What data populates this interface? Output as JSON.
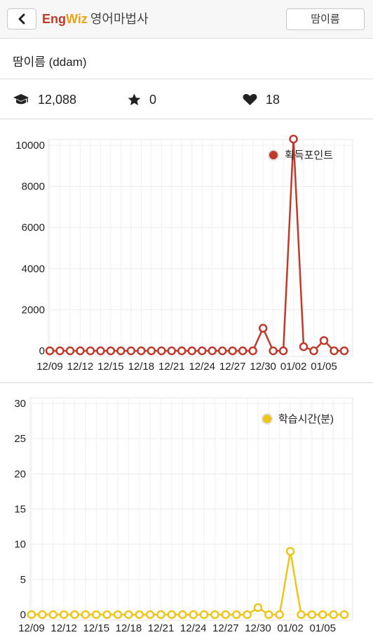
{
  "header": {
    "back_icon": "chevron-left-icon",
    "brand_eng": "Eng",
    "brand_wiz": "Wiz",
    "brand_rest": "영어마법사",
    "user_button": "땀이름"
  },
  "profile": {
    "name": "땀이름 (ddam)"
  },
  "stats": [
    {
      "icon": "graduation-cap-icon",
      "value": "12,088"
    },
    {
      "icon": "star-icon",
      "value": "0"
    },
    {
      "icon": "heart-icon",
      "value": "18"
    }
  ],
  "chart_data": [
    {
      "type": "line",
      "legend": "획득포인트",
      "legend_position": "top-right",
      "color": "#c0392b",
      "grid": true,
      "ylim": [
        0,
        10000
      ],
      "yticks": [
        0,
        2000,
        4000,
        6000,
        8000,
        10000
      ],
      "x": [
        "12/09",
        "12/10",
        "12/11",
        "12/12",
        "12/13",
        "12/14",
        "12/15",
        "12/16",
        "12/17",
        "12/18",
        "12/19",
        "12/20",
        "12/21",
        "12/22",
        "12/23",
        "12/24",
        "12/25",
        "12/26",
        "12/27",
        "12/28",
        "12/29",
        "12/30",
        "12/31",
        "01/01",
        "01/02",
        "01/03",
        "01/04",
        "01/05",
        "01/06",
        "01/07"
      ],
      "xtick_labels": [
        "12/09",
        "12/12",
        "12/15",
        "12/18",
        "12/21",
        "12/24",
        "12/27",
        "12/30",
        "01/02",
        "01/05"
      ],
      "series": [
        {
          "name": "획득포인트",
          "values": [
            0,
            0,
            0,
            0,
            0,
            0,
            0,
            0,
            0,
            0,
            0,
            0,
            0,
            0,
            0,
            0,
            0,
            0,
            0,
            0,
            0,
            1100,
            0,
            0,
            10300,
            200,
            0,
            500,
            0,
            0
          ]
        }
      ]
    },
    {
      "type": "line",
      "legend": "학습시간(분)",
      "legend_position": "top-right",
      "color": "#f0c419",
      "grid": true,
      "ylim": [
        0,
        30
      ],
      "yticks": [
        0,
        5,
        10,
        15,
        20,
        25,
        30
      ],
      "x": [
        "12/09",
        "12/10",
        "12/11",
        "12/12",
        "12/13",
        "12/14",
        "12/15",
        "12/16",
        "12/17",
        "12/18",
        "12/19",
        "12/20",
        "12/21",
        "12/22",
        "12/23",
        "12/24",
        "12/25",
        "12/26",
        "12/27",
        "12/28",
        "12/29",
        "12/30",
        "12/31",
        "01/01",
        "01/02",
        "01/03",
        "01/04",
        "01/05",
        "01/06",
        "01/07"
      ],
      "xtick_labels": [
        "12/09",
        "12/12",
        "12/15",
        "12/18",
        "12/21",
        "12/24",
        "12/27",
        "12/30",
        "01/02",
        "01/05"
      ],
      "series": [
        {
          "name": "학습시간(분)",
          "values": [
            0,
            0,
            0,
            0,
            0,
            0,
            0,
            0,
            0,
            0,
            0,
            0,
            0,
            0,
            0,
            0,
            0,
            0,
            0,
            0,
            0,
            1,
            0,
            0,
            9,
            0,
            0,
            0,
            0,
            0
          ]
        }
      ]
    }
  ]
}
